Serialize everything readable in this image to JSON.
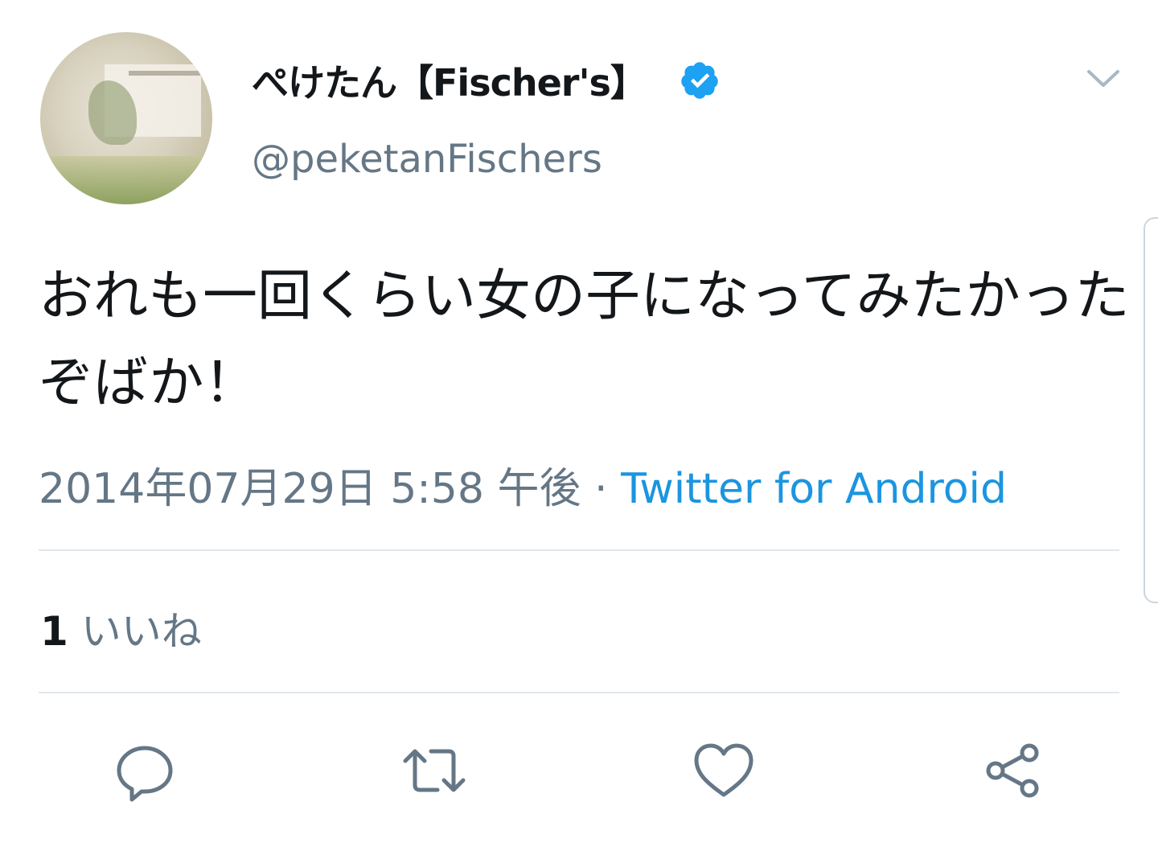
{
  "tweet": {
    "display_name": "ぺけたん【Fischer's】",
    "handle": "@peketanFischers",
    "text": "おれも一回くらい女の子になってみたかったぞばか！",
    "timestamp": "2014年07月29日 5:58 午後",
    "separator": " · ",
    "source": "Twitter for Android",
    "likes_count": "1",
    "likes_label": "いいね"
  },
  "icons": {
    "verified": "verified-badge-icon",
    "menu": "chevron-down-icon",
    "reply": "reply-icon",
    "retweet": "retweet-icon",
    "like": "heart-icon",
    "share": "share-icon"
  },
  "colors": {
    "primary_text": "#14171a",
    "secondary_text": "#657786",
    "link": "#1b95e0",
    "verified": "#1da1f2",
    "divider": "#e1e8ed"
  }
}
